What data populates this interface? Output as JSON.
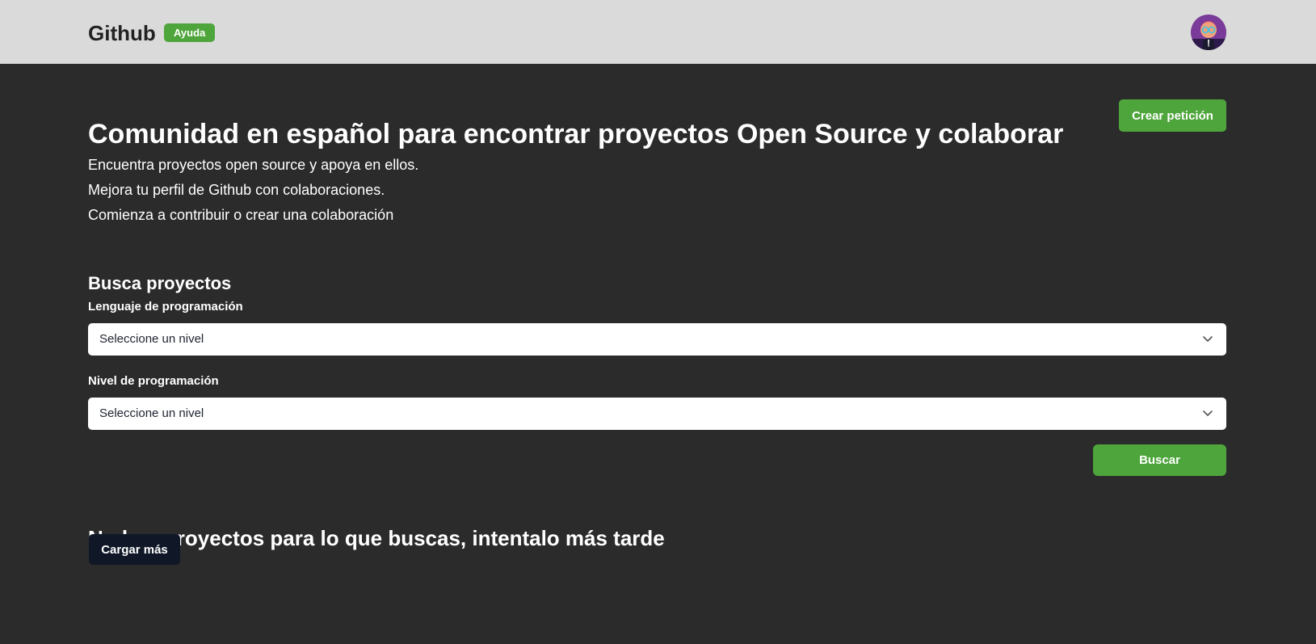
{
  "header": {
    "brand": "Github",
    "badge": "Ayuda",
    "avatar_icon": "user-avatar-icon"
  },
  "hero": {
    "title": "Comunidad en español para encontrar proyectos Open Source y colaborar",
    "create_button": "Crear petición",
    "lines": [
      "Encuentra proyectos open source y apoya en ellos.",
      "Mejora tu perfil de Github con colaboraciones.",
      "Comienza a contribuir o crear una colaboración"
    ]
  },
  "search": {
    "title": "Busca proyectos",
    "language_label": "Lenguaje de programación",
    "language_value": "Seleccione un nivel",
    "level_label": "Nivel de programación",
    "level_value": "Seleccione un nivel",
    "button": "Buscar"
  },
  "results": {
    "empty_message": "No hay proyectos para lo que buscas, intentalo más tarde",
    "load_more": "Cargar más"
  },
  "colors": {
    "background": "#2b2b2b",
    "topbar": "#dadada",
    "accent": "#4ea53b",
    "dark_button": "#101827"
  }
}
